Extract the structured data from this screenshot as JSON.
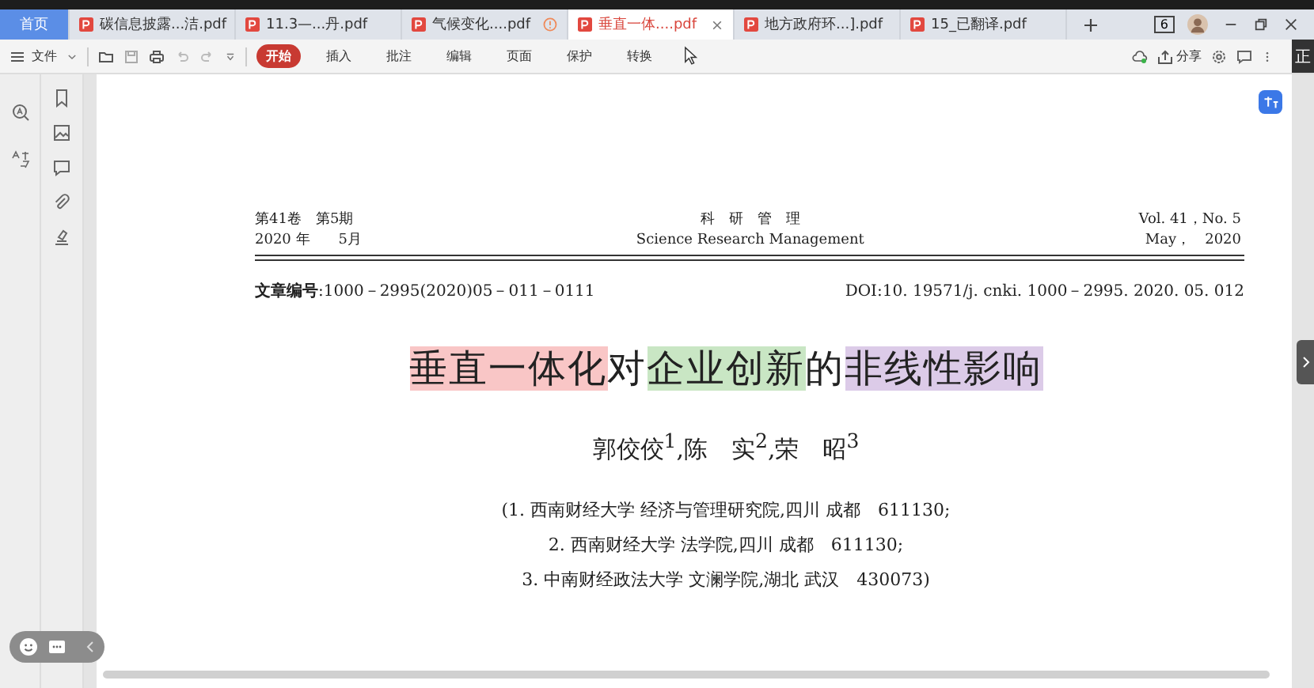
{
  "tabs": [
    {
      "kind": "home",
      "label": "首页",
      "selected": false
    },
    {
      "kind": "file",
      "label": "碳信息披露...洁.pdf",
      "selected": false,
      "alert": false
    },
    {
      "kind": "file",
      "label": "11.3—...丹.pdf",
      "selected": false,
      "alert": false
    },
    {
      "kind": "file",
      "label": "气候变化....pdf",
      "selected": false,
      "alert": true
    },
    {
      "kind": "file",
      "label": "垂直一体....pdf",
      "selected": true,
      "alert": false
    },
    {
      "kind": "file",
      "label": "地方政府环...].pdf",
      "selected": false,
      "alert": false
    },
    {
      "kind": "file",
      "label": "15_已翻译.pdf",
      "selected": false,
      "alert": false
    }
  ],
  "window_badge": "6",
  "file_menu": "文件",
  "ribbon_tabs": [
    {
      "label": "开始",
      "selected": true
    },
    {
      "label": "插入",
      "selected": false
    },
    {
      "label": "批注",
      "selected": false
    },
    {
      "label": "编辑",
      "selected": false
    },
    {
      "label": "页面",
      "selected": false
    },
    {
      "label": "保护",
      "selected": false
    },
    {
      "label": "转换",
      "selected": false
    }
  ],
  "share_label": "分享",
  "side_tab": "正",
  "document": {
    "header_left": [
      "第41卷　第5期",
      "2020 年　　5月"
    ],
    "header_center": [
      "科　研　管　理",
      "Science Research Management"
    ],
    "header_right": [
      "Vol. 41，No. 5",
      "May，　2020"
    ],
    "article_number": "**文章编号**:1000－2995(2020)05－011－0111",
    "doi": "DOI:10. 19571/j. cnki. 1000－2995. 2020. 05. 012",
    "title_segments": [
      {
        "text": "垂直一体化",
        "color": "#f9c6c6"
      },
      {
        "text": "对"
      },
      {
        "text": "企业创新",
        "color": "#c9e6c4"
      },
      {
        "text": "的"
      },
      {
        "text": "非线性影响",
        "color": "#dccbe8"
      }
    ],
    "authors": "郭佼佼$^{1}$,陈　实$^{2}$,荣　昭$^{3}$",
    "affiliations": [
      "(1. 西南财经大学 经济与管理研究院,四川 成都　611130;",
      "2. 西南财经大学 法学院,四川 成都　611130;",
      "3. 中南财经政法大学 文澜学院,湖北 武汉　430073)"
    ]
  }
}
